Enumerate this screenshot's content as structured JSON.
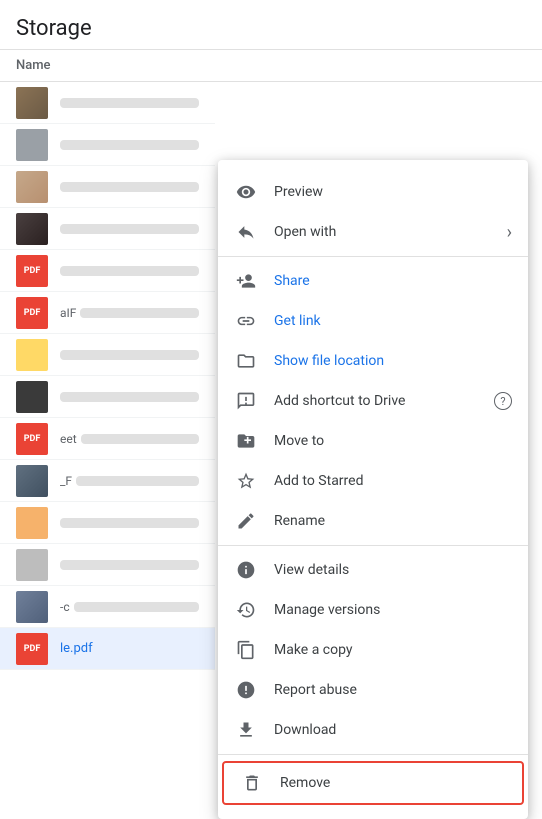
{
  "header": {
    "title": "Storage",
    "name_col": "Name"
  },
  "files": [
    {
      "id": 1,
      "thumb_type": "photo",
      "name_width": "75%"
    },
    {
      "id": 2,
      "thumb_type": "grey",
      "name_width": "65%"
    },
    {
      "id": 3,
      "thumb_type": "tan",
      "name_width": "70%"
    },
    {
      "id": 4,
      "thumb_type": "photo2",
      "name_width": "60%"
    },
    {
      "id": 5,
      "thumb_type": "pdf",
      "label": "PDF",
      "name_width": "55%"
    },
    {
      "id": 6,
      "thumb_type": "pdf",
      "label": "PDF",
      "name_width": "45%",
      "extra": "aIF"
    },
    {
      "id": 7,
      "thumb_type": "folder2",
      "name_width": "65%"
    },
    {
      "id": 8,
      "thumb_type": "dark",
      "name_width": "70%"
    },
    {
      "id": 9,
      "thumb_type": "pdf",
      "label": "PDF",
      "name_width": "50%",
      "extra": "eet"
    },
    {
      "id": 10,
      "thumb_type": "photo",
      "name_width": "60%",
      "extra": "_F"
    },
    {
      "id": 11,
      "thumb_type": "folder2",
      "name_width": "65%"
    },
    {
      "id": 12,
      "thumb_type": "grey2",
      "name_width": "60%"
    },
    {
      "id": 13,
      "thumb_type": "photo2",
      "name_width": "55%",
      "extra": "-c"
    },
    {
      "id": 14,
      "thumb_type": "pdf",
      "label": "PDF",
      "name_width": "70%",
      "extra": "le.pdf",
      "highlighted": true
    }
  ],
  "menu": {
    "items": [
      {
        "section": 1,
        "entries": [
          {
            "id": "preview",
            "label": "Preview",
            "icon": "eye",
            "has_arrow": false
          },
          {
            "id": "open-with",
            "label": "Open with",
            "icon": "open-with",
            "has_arrow": true
          }
        ]
      },
      {
        "section": 2,
        "entries": [
          {
            "id": "share",
            "label": "Share",
            "icon": "person-add",
            "blue": true
          },
          {
            "id": "get-link",
            "label": "Get link",
            "icon": "link",
            "blue": true
          },
          {
            "id": "show-file-location",
            "label": "Show file location",
            "icon": "folder-open",
            "blue": true
          },
          {
            "id": "add-shortcut",
            "label": "Add shortcut to Drive",
            "icon": "drive-shortcut",
            "has_help": true
          },
          {
            "id": "move-to",
            "label": "Move to",
            "icon": "move-to"
          },
          {
            "id": "add-starred",
            "label": "Add to Starred",
            "icon": "star"
          },
          {
            "id": "rename",
            "label": "Rename",
            "icon": "edit"
          }
        ]
      },
      {
        "section": 3,
        "entries": [
          {
            "id": "view-details",
            "label": "View details",
            "icon": "info"
          },
          {
            "id": "manage-versions",
            "label": "Manage versions",
            "icon": "history"
          },
          {
            "id": "make-copy",
            "label": "Make a copy",
            "icon": "copy"
          },
          {
            "id": "report-abuse",
            "label": "Report abuse",
            "icon": "report"
          },
          {
            "id": "download",
            "label": "Download",
            "icon": "download"
          }
        ]
      },
      {
        "section": 4,
        "entries": [
          {
            "id": "remove",
            "label": "Remove",
            "icon": "trash",
            "is_remove": true
          }
        ]
      }
    ]
  }
}
